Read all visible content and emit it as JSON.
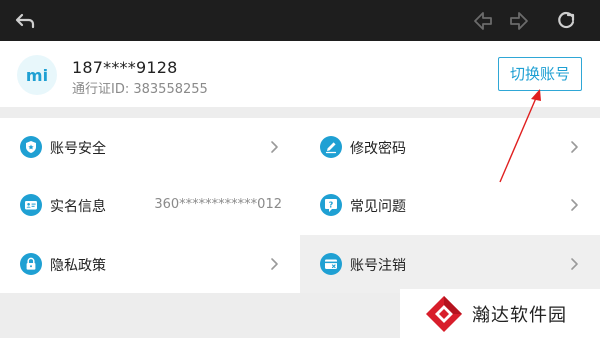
{
  "toolbar": {
    "back_icon": "back-arrow-icon",
    "prev_icon": "prev-diamond-icon",
    "next_icon": "next-diamond-icon",
    "refresh_icon": "refresh-icon"
  },
  "account": {
    "phone": "187****9128",
    "passport_id": "通行证ID: 383558255",
    "switch_label": "切换账号"
  },
  "menu": {
    "items": [
      {
        "label": "账号安全",
        "icon": "shield-icon",
        "value": ""
      },
      {
        "label": "修改密码",
        "icon": "edit-pen-icon",
        "value": ""
      },
      {
        "label": "实名信息",
        "icon": "id-card-icon",
        "value": "360************012"
      },
      {
        "label": "常见问题",
        "icon": "question-icon",
        "value": ""
      },
      {
        "label": "隐私政策",
        "icon": "lock-icon",
        "value": ""
      },
      {
        "label": "账号注销",
        "icon": "account-cancel-icon",
        "value": ""
      }
    ]
  },
  "watermark": {
    "text": "瀚达软件园"
  },
  "colors": {
    "accent": "#1fa0d3",
    "arrow": "#e02020",
    "topbar": "#1e1e1e"
  }
}
